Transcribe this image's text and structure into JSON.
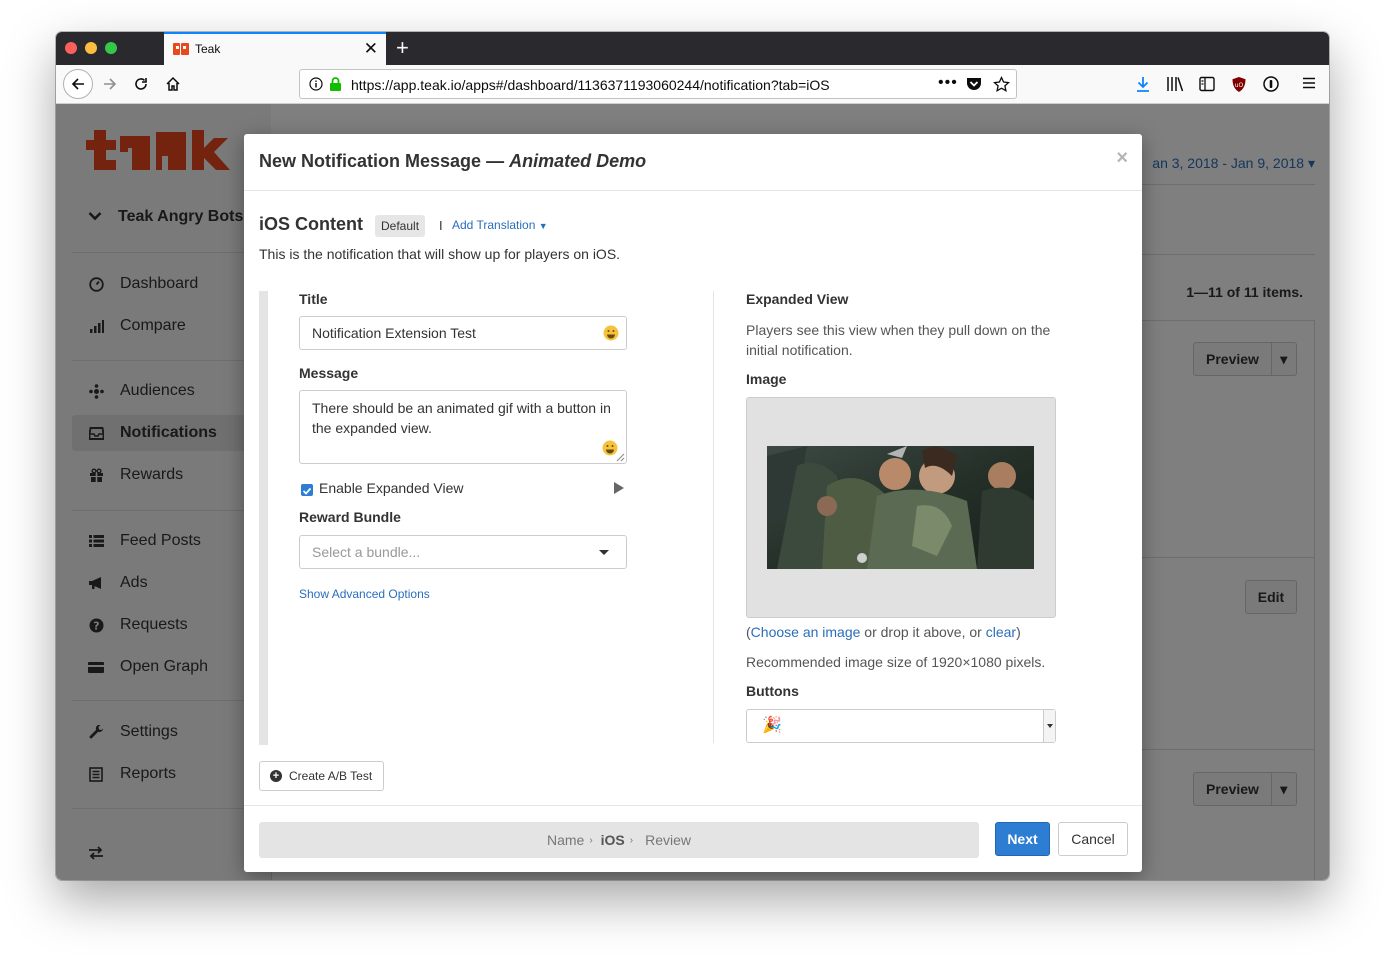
{
  "browser": {
    "tab_title": "Teak",
    "new_tab": "+",
    "url": "https://app.teak.io/apps#/dashboard/1136371193060244/notification?tab=iOS",
    "url_dots": "•••"
  },
  "sidebar": {
    "app_name": "Teak Angry Bots",
    "items": [
      {
        "label": "Dashboard",
        "icon": "dashboard-icon"
      },
      {
        "label": "Compare",
        "icon": "bar-chart-icon"
      },
      {
        "label": "Audiences",
        "icon": "audiences-icon"
      },
      {
        "label": "Notifications",
        "icon": "inbox-icon"
      },
      {
        "label": "Rewards",
        "icon": "gift-icon"
      },
      {
        "label": "Feed Posts",
        "icon": "list-icon"
      },
      {
        "label": "Ads",
        "icon": "bullhorn-icon"
      },
      {
        "label": "Requests",
        "icon": "question-icon"
      },
      {
        "label": "Open Graph",
        "icon": "card-icon"
      },
      {
        "label": "Settings",
        "icon": "wrench-icon"
      },
      {
        "label": "Reports",
        "icon": "report-icon"
      }
    ]
  },
  "main": {
    "date_range": "an 3, 2018 - Jan 9, 2018",
    "items_count": "1—11 of 11 items.",
    "preview_label": "Preview",
    "edit_label": "Edit"
  },
  "modal": {
    "title": "New Notification Message",
    "title_dash": "—",
    "title_app": "Animated Demo",
    "close": "×",
    "section_heading": "iOS Content",
    "default_badge": "Default",
    "separator": "I",
    "add_translation": "Add Translation",
    "intro": "This is the notification that will show up for players on iOS.",
    "title_label": "Title",
    "title_value": "Notification Extension Test",
    "message_label": "Message",
    "message_value": "There should be an animated gif with a button in the expanded view.",
    "enable_expanded": "Enable Expanded View",
    "reward_label": "Reward Bundle",
    "reward_placeholder": "Select a bundle...",
    "advanced_link": "Show Advanced Options",
    "expanded_heading": "Expanded View",
    "expanded_desc": "Players see this view when they pull down on the initial notification.",
    "image_label": "Image",
    "image_paren_open": "(",
    "choose_image": "Choose an image",
    "image_or_drop": " or drop it above, or ",
    "image_clear": "clear",
    "image_paren_close": ")",
    "image_size_note": "Recommended image size of 1920×1080 pixels.",
    "buttons_label": "Buttons",
    "buttons_value": "🎉",
    "ab_test": "Create A/B Test",
    "steps": {
      "name": "Name",
      "ios": "iOS",
      "review": "Review",
      "sep": "›"
    },
    "next": "Next",
    "cancel": "Cancel"
  },
  "colors": {
    "accent": "#2d7dd2",
    "link": "#2a6ebb",
    "brand": "#e8491d"
  }
}
